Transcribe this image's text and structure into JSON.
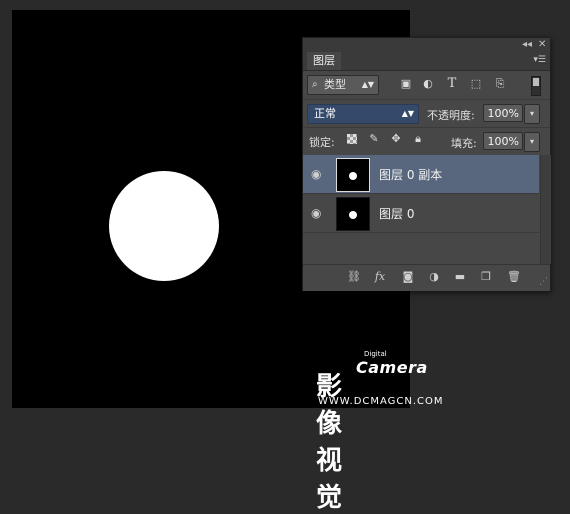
{
  "panel": {
    "collapse_label": "◂◂",
    "close_label": "✕",
    "tab": "图层",
    "menu_icon": "panel-menu-icon"
  },
  "filter": {
    "kind_label": "类型",
    "icons": [
      "image-filter-icon",
      "adjustment-filter-icon",
      "type-filter-icon",
      "shape-filter-icon",
      "smart-object-filter-icon"
    ]
  },
  "blend": {
    "mode": "正常",
    "opacity_label": "不透明度:",
    "opacity_value": "100%"
  },
  "lock": {
    "label": "锁定:",
    "fill_label": "填充:",
    "fill_value": "100%"
  },
  "layers": [
    {
      "name": "图层 0 副本",
      "selected": true
    },
    {
      "name": "图层 0",
      "selected": false
    }
  ],
  "watermark": {
    "digital": "Digital",
    "camera": "Camera",
    "chinese": "影像视觉",
    "url": "WWW.DCMAGCN.COM"
  },
  "colors": {
    "canvas": "#000000",
    "panel": "#474747",
    "selected_row": "#58677d",
    "blend_field": "#35496a"
  }
}
